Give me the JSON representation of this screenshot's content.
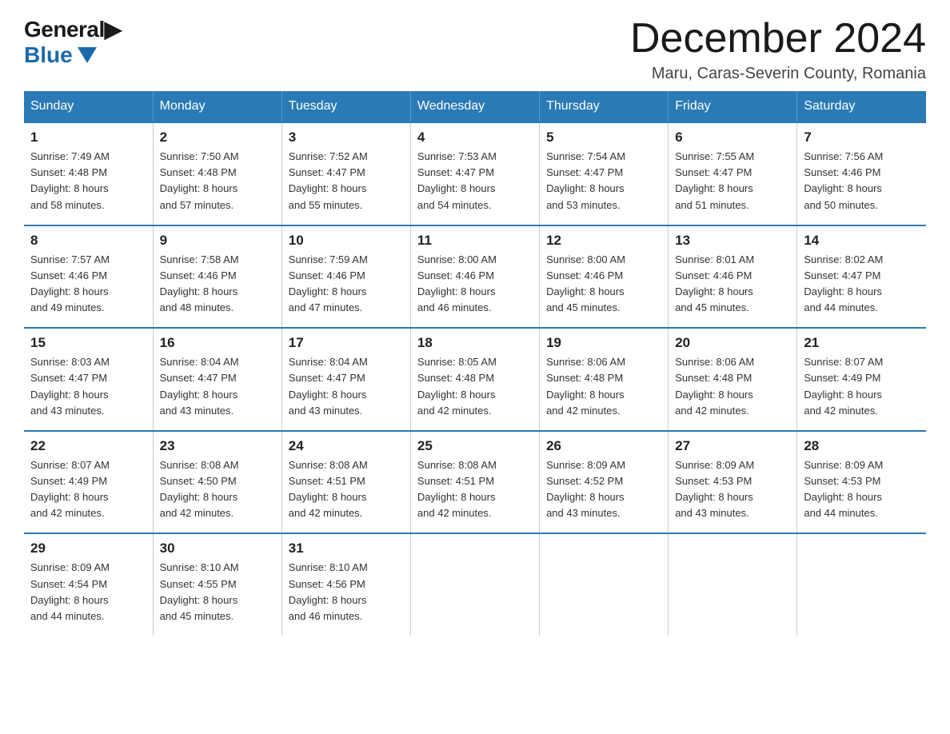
{
  "logo": {
    "general": "General",
    "blue": "Blue"
  },
  "title": {
    "month": "December 2024",
    "location": "Maru, Caras-Severin County, Romania"
  },
  "weekdays": [
    "Sunday",
    "Monday",
    "Tuesday",
    "Wednesday",
    "Thursday",
    "Friday",
    "Saturday"
  ],
  "weeks": [
    [
      {
        "day": "1",
        "sunrise": "7:49 AM",
        "sunset": "4:48 PM",
        "daylight": "8 hours and 58 minutes."
      },
      {
        "day": "2",
        "sunrise": "7:50 AM",
        "sunset": "4:48 PM",
        "daylight": "8 hours and 57 minutes."
      },
      {
        "day": "3",
        "sunrise": "7:52 AM",
        "sunset": "4:47 PM",
        "daylight": "8 hours and 55 minutes."
      },
      {
        "day": "4",
        "sunrise": "7:53 AM",
        "sunset": "4:47 PM",
        "daylight": "8 hours and 54 minutes."
      },
      {
        "day": "5",
        "sunrise": "7:54 AM",
        "sunset": "4:47 PM",
        "daylight": "8 hours and 53 minutes."
      },
      {
        "day": "6",
        "sunrise": "7:55 AM",
        "sunset": "4:47 PM",
        "daylight": "8 hours and 51 minutes."
      },
      {
        "day": "7",
        "sunrise": "7:56 AM",
        "sunset": "4:46 PM",
        "daylight": "8 hours and 50 minutes."
      }
    ],
    [
      {
        "day": "8",
        "sunrise": "7:57 AM",
        "sunset": "4:46 PM",
        "daylight": "8 hours and 49 minutes."
      },
      {
        "day": "9",
        "sunrise": "7:58 AM",
        "sunset": "4:46 PM",
        "daylight": "8 hours and 48 minutes."
      },
      {
        "day": "10",
        "sunrise": "7:59 AM",
        "sunset": "4:46 PM",
        "daylight": "8 hours and 47 minutes."
      },
      {
        "day": "11",
        "sunrise": "8:00 AM",
        "sunset": "4:46 PM",
        "daylight": "8 hours and 46 minutes."
      },
      {
        "day": "12",
        "sunrise": "8:00 AM",
        "sunset": "4:46 PM",
        "daylight": "8 hours and 45 minutes."
      },
      {
        "day": "13",
        "sunrise": "8:01 AM",
        "sunset": "4:46 PM",
        "daylight": "8 hours and 45 minutes."
      },
      {
        "day": "14",
        "sunrise": "8:02 AM",
        "sunset": "4:47 PM",
        "daylight": "8 hours and 44 minutes."
      }
    ],
    [
      {
        "day": "15",
        "sunrise": "8:03 AM",
        "sunset": "4:47 PM",
        "daylight": "8 hours and 43 minutes."
      },
      {
        "day": "16",
        "sunrise": "8:04 AM",
        "sunset": "4:47 PM",
        "daylight": "8 hours and 43 minutes."
      },
      {
        "day": "17",
        "sunrise": "8:04 AM",
        "sunset": "4:47 PM",
        "daylight": "8 hours and 43 minutes."
      },
      {
        "day": "18",
        "sunrise": "8:05 AM",
        "sunset": "4:48 PM",
        "daylight": "8 hours and 42 minutes."
      },
      {
        "day": "19",
        "sunrise": "8:06 AM",
        "sunset": "4:48 PM",
        "daylight": "8 hours and 42 minutes."
      },
      {
        "day": "20",
        "sunrise": "8:06 AM",
        "sunset": "4:48 PM",
        "daylight": "8 hours and 42 minutes."
      },
      {
        "day": "21",
        "sunrise": "8:07 AM",
        "sunset": "4:49 PM",
        "daylight": "8 hours and 42 minutes."
      }
    ],
    [
      {
        "day": "22",
        "sunrise": "8:07 AM",
        "sunset": "4:49 PM",
        "daylight": "8 hours and 42 minutes."
      },
      {
        "day": "23",
        "sunrise": "8:08 AM",
        "sunset": "4:50 PM",
        "daylight": "8 hours and 42 minutes."
      },
      {
        "day": "24",
        "sunrise": "8:08 AM",
        "sunset": "4:51 PM",
        "daylight": "8 hours and 42 minutes."
      },
      {
        "day": "25",
        "sunrise": "8:08 AM",
        "sunset": "4:51 PM",
        "daylight": "8 hours and 42 minutes."
      },
      {
        "day": "26",
        "sunrise": "8:09 AM",
        "sunset": "4:52 PM",
        "daylight": "8 hours and 43 minutes."
      },
      {
        "day": "27",
        "sunrise": "8:09 AM",
        "sunset": "4:53 PM",
        "daylight": "8 hours and 43 minutes."
      },
      {
        "day": "28",
        "sunrise": "8:09 AM",
        "sunset": "4:53 PM",
        "daylight": "8 hours and 44 minutes."
      }
    ],
    [
      {
        "day": "29",
        "sunrise": "8:09 AM",
        "sunset": "4:54 PM",
        "daylight": "8 hours and 44 minutes."
      },
      {
        "day": "30",
        "sunrise": "8:10 AM",
        "sunset": "4:55 PM",
        "daylight": "8 hours and 45 minutes."
      },
      {
        "day": "31",
        "sunrise": "8:10 AM",
        "sunset": "4:56 PM",
        "daylight": "8 hours and 46 minutes."
      },
      null,
      null,
      null,
      null
    ]
  ]
}
